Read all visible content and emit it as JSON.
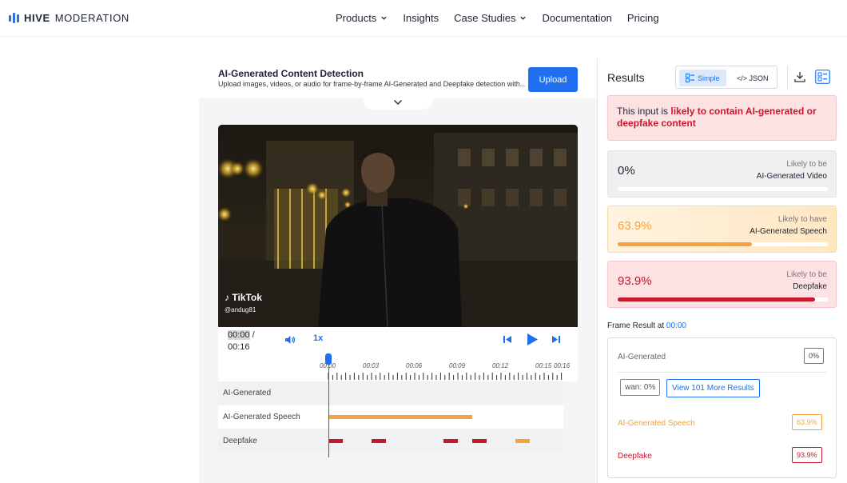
{
  "brand": {
    "name_bold": "HIVE",
    "name_rest": "MODERATION"
  },
  "nav": {
    "items": [
      "Products",
      "Insights",
      "Case Studies",
      "Documentation",
      "Pricing"
    ]
  },
  "header": {
    "title": "AI-Generated Content Detection",
    "subtitle": "Upload images, videos, or audio for frame-by-frame AI-Generated and Deepfake detection with...",
    "upload_label": "Upload"
  },
  "video": {
    "watermark": "TikTok",
    "user": "@andug81"
  },
  "controls": {
    "current_time": "00:00",
    "sep": " / ",
    "duration": "00:16",
    "speed": "1x"
  },
  "timeline": {
    "ticks": [
      "00:00",
      "00:03",
      "00:06",
      "00:09",
      "00:12",
      "00:15",
      "00:16"
    ],
    "rows": [
      {
        "label": "AI-Generated"
      },
      {
        "label": "AI-Generated Speech"
      },
      {
        "label": "Deepfake"
      }
    ]
  },
  "results": {
    "title": "Results",
    "toggle_simple": "Simple",
    "toggle_json": "</> JSON",
    "banner_prefix": "This input is ",
    "banner_emph": "likely to contain AI-generated or deepfake content",
    "cards": [
      {
        "pct": "0%",
        "l1": "Likely to be",
        "l2": "AI-Generated Video",
        "fill": 0.0,
        "color": "#999999"
      },
      {
        "pct": "63.9%",
        "l1": "Likely to have",
        "l2": "AI-Generated Speech",
        "fill": 0.639,
        "color": "#f4a340"
      },
      {
        "pct": "93.9%",
        "l1": "Likely to be",
        "l2": "Deepfake",
        "fill": 0.939,
        "color": "#c8172b"
      }
    ],
    "frame_label": "Frame Result at ",
    "frame_time": "00:00",
    "frame": {
      "ai_generated_label": "AI-Generated",
      "ai_generated_value": "0%",
      "wan_pill": "wan: 0%",
      "more_button": "View 101 More Results",
      "speech_label": "AI-Generated Speech",
      "speech_value": "63.9%",
      "deepfake_label": "Deepfake",
      "deepfake_value": "93.9%"
    }
  },
  "colors": {
    "accent": "#1f6ff0",
    "speech": "#f4a340",
    "deepfake": "#c8172b"
  }
}
